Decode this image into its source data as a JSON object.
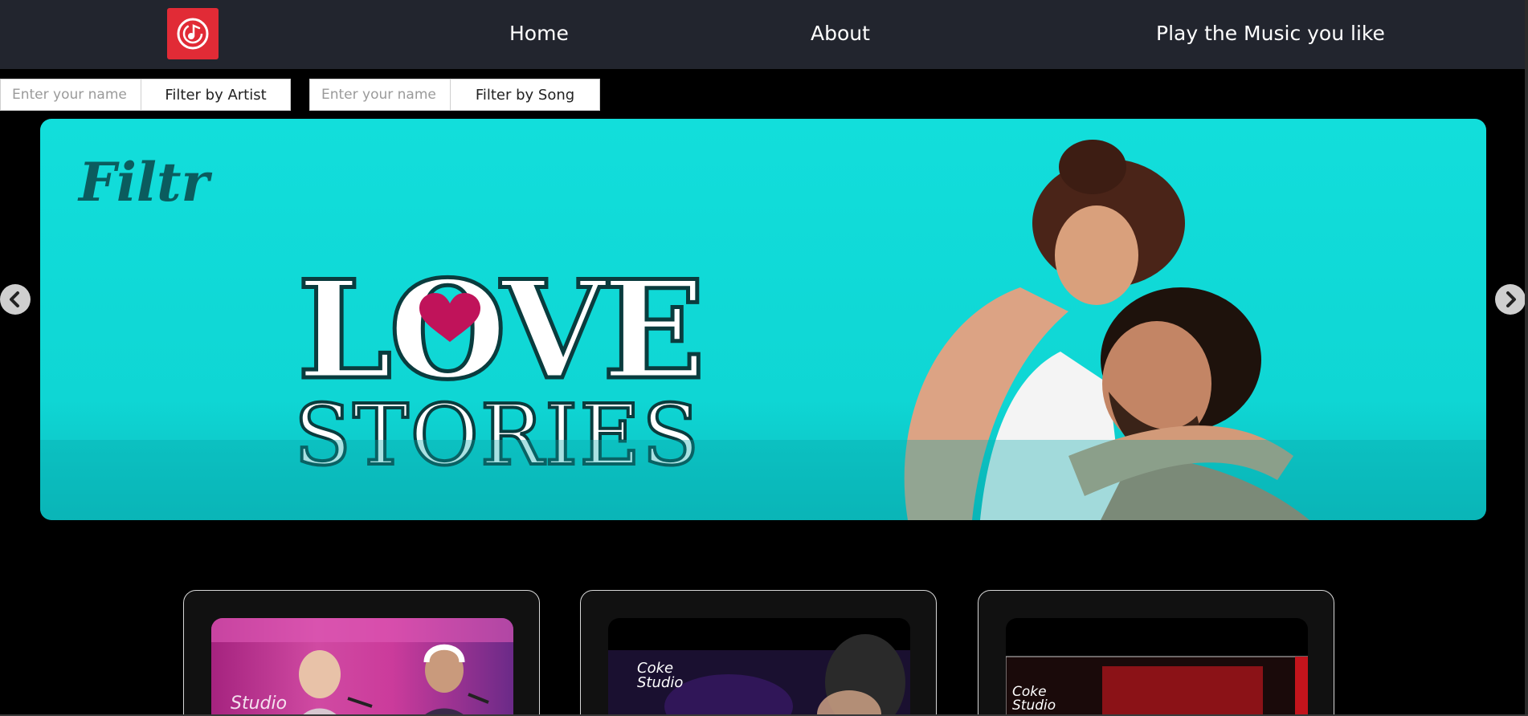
{
  "navbar": {
    "logo_icon": "music-note-icon",
    "links": [
      "Home",
      "About",
      "Play the Music you like"
    ]
  },
  "filters": {
    "artist": {
      "placeholder": "Enter your name ...",
      "button": "Filter by Artist"
    },
    "song": {
      "placeholder": "Enter your name ...",
      "button": "Filter by Song"
    }
  },
  "carousel": {
    "brand": "Filtr",
    "headline": "LOVE",
    "subheadline": "STORIES",
    "prev_icon": "chevron-left-icon",
    "next_icon": "chevron-right-icon"
  },
  "cards": [
    {
      "thumb_text": "Studio"
    },
    {
      "thumb_text": "Coke Studio"
    },
    {
      "thumb_text": "Coke Studio"
    }
  ],
  "colors": {
    "navbar_bg": "#22252e",
    "logo_bg": "#e12b36",
    "banner_bg": "#12dedb",
    "heart": "#c0135a"
  }
}
